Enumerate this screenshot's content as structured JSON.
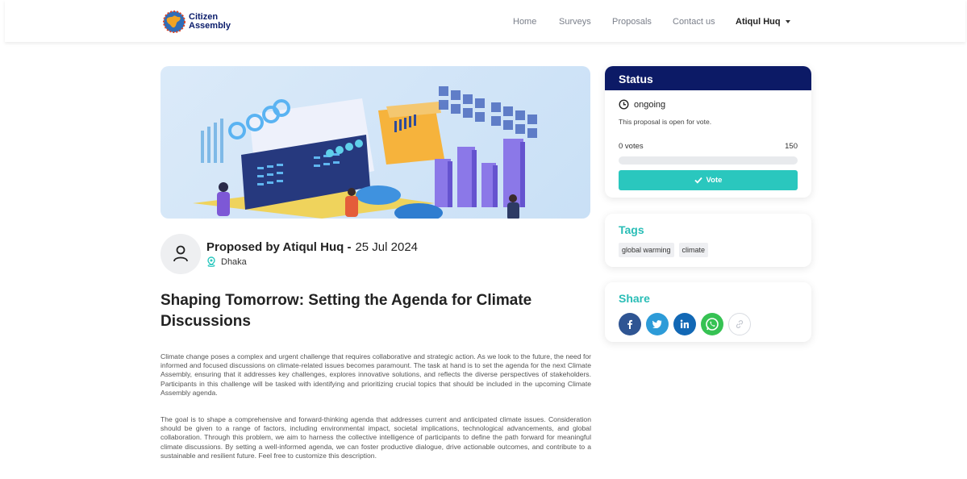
{
  "brand": {
    "line1": "Citizen",
    "line2": "Assembly"
  },
  "nav": {
    "home": "Home",
    "surveys": "Surveys",
    "proposals": "Proposals",
    "contact": "Contact us",
    "user": "Atiqul Huq"
  },
  "proposal": {
    "author_label": "Proposed by Atiqul Huq -",
    "date": "25 Jul 2024",
    "location": "Dhaka",
    "title": "Shaping Tomorrow: Setting the Agenda for Climate Discussions",
    "paragraph1": "Climate change poses a complex and urgent challenge that requires collaborative and strategic action. As we look to the future, the need for informed and focused discussions on climate-related issues becomes paramount. The task at hand is to set the agenda for the next Climate Assembly, ensuring that it addresses key challenges, explores innovative solutions, and reflects the diverse perspectives of stakeholders. Participants in this challenge will be tasked with identifying and prioritizing crucial topics that should be included in the upcoming Climate Assembly agenda.",
    "paragraph2": "The goal is to shape a comprehensive and forward-thinking agenda that addresses current and anticipated climate issues. Consideration should be given to a range of factors, including environmental impact, societal implications, technological advancements, and global collaboration. Through this problem, we aim to harness the collective intelligence of participants to define the path forward for meaningful climate discussions. By setting a well-informed agenda, we can foster productive dialogue, drive actionable outcomes, and contribute to a sustainable and resilient future. Feel free to customize this description."
  },
  "status": {
    "heading": "Status",
    "state": "ongoing",
    "note": "This proposal is open for vote.",
    "votes_label": "0 votes",
    "votes_goal": "150",
    "progress_fraction": 0,
    "vote_button": "Vote"
  },
  "tags": {
    "heading": "Tags",
    "items": [
      "global warming",
      "climate"
    ]
  },
  "share": {
    "heading": "Share"
  },
  "colors": {
    "navy": "#0c1a66",
    "teal": "#2ac7be",
    "facebook": "#2f5593",
    "twitter": "#2d9bd8",
    "linkedin": "#1268b5",
    "whatsapp": "#36c253"
  },
  "icons": {
    "brand": "globe-logo",
    "clock": "clock-icon",
    "location": "location-pin-icon",
    "user": "user-icon",
    "check": "check-icon"
  }
}
